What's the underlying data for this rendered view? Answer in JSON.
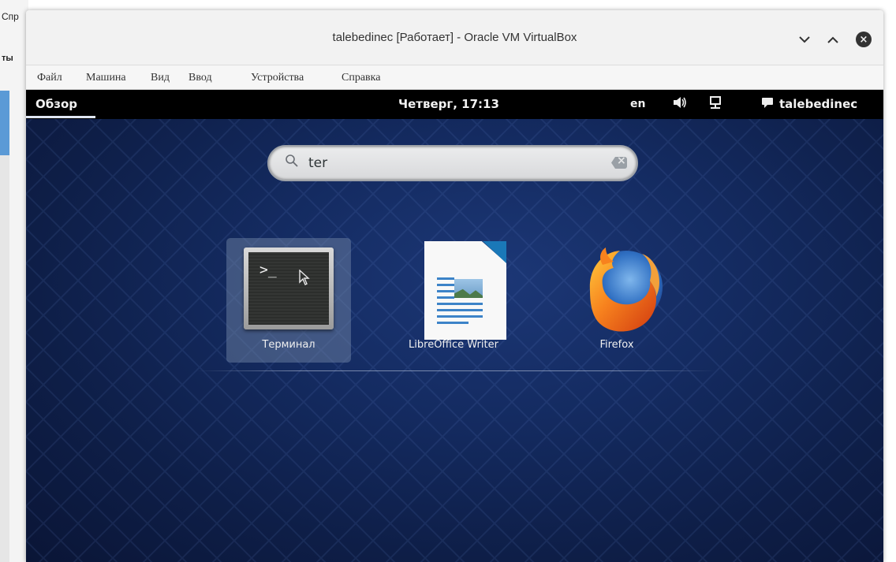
{
  "host": {
    "fragment_top": "Спр",
    "fragment_mid": "ты"
  },
  "window": {
    "title": "talebedinec [Работает] - Oracle VM VirtualBox",
    "buttons": [
      "chevron-down-icon",
      "chevron-up-icon",
      "close-icon"
    ]
  },
  "menubar": {
    "items": [
      "Файл",
      "Машина",
      "Вид",
      "Ввод",
      "Устройства",
      "Справка"
    ]
  },
  "guest_topbar": {
    "activities": "Обзор",
    "clock": "Четверг, 17:13",
    "language": "en",
    "volume_icon": "🔊",
    "network_icon": "network-icon",
    "user": "talebedinec"
  },
  "search": {
    "value": "ter",
    "placeholder": ""
  },
  "results": [
    {
      "label": "Терминал",
      "icon": "terminal-icon",
      "selected": true
    },
    {
      "label": "LibreOffice Writer",
      "icon": "libreoffice-writer-icon",
      "selected": false
    },
    {
      "label": "Firefox",
      "icon": "firefox-icon",
      "selected": false
    }
  ],
  "colors": {
    "topbar": "#000000",
    "desktop": "#142b61",
    "selection": "#6f809e"
  }
}
